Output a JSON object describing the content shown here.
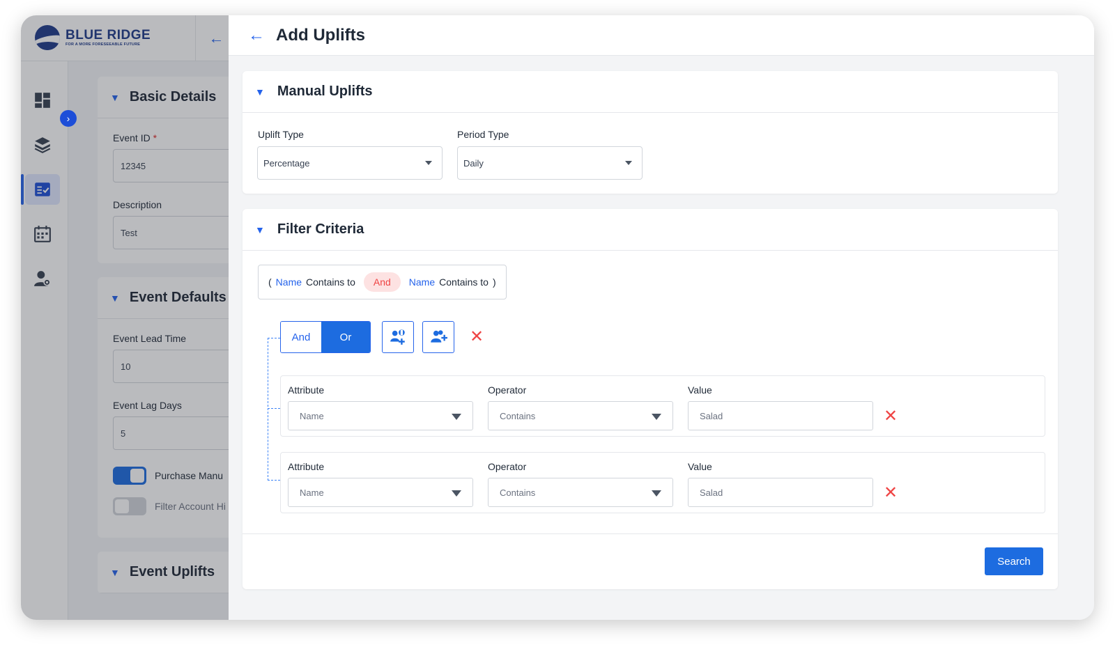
{
  "brand": {
    "name": "BLUE RIDGE",
    "tagline": "FOR A MORE FORESEEABLE FUTURE"
  },
  "background_form": {
    "basic_details": {
      "title": "Basic Details",
      "event_id_label": "Event ID",
      "event_id_required": "*",
      "event_id_value": "12345",
      "description_label": "Description",
      "description_value": "Test"
    },
    "event_defaults": {
      "title": "Event Defaults",
      "lead_time_label": "Event Lead Time",
      "lead_time_value": "10",
      "lag_days_label": "Event Lag Days",
      "lag_days_value": "5",
      "purchase_toggle_label": "Purchase Manu",
      "purchase_toggle_on": true,
      "filter_toggle_label": "Filter Account Hi",
      "filter_toggle_on": false
    },
    "event_uplifts": {
      "title": "Event Uplifts"
    }
  },
  "drawer": {
    "title": "Add Uplifts",
    "manual_uplifts": {
      "title": "Manual Uplifts",
      "uplift_type_label": "Uplift Type",
      "uplift_type_value": "Percentage",
      "period_type_label": "Period Type",
      "period_type_value": "Daily"
    },
    "filter_criteria": {
      "title": "Filter Criteria",
      "summary": {
        "open_paren": "(",
        "attr1": "Name",
        "op1": "Contains to",
        "joiner": "And",
        "attr2": "Name",
        "op2": "Contains to",
        "close_paren": ")"
      },
      "logic": {
        "and_label": "And",
        "or_label": "Or",
        "selected": "Or"
      },
      "conditions": [
        {
          "attribute_label": "Attribute",
          "attribute_value": "Name",
          "operator_label": "Operator",
          "operator_value": "Contains",
          "value_label": "Value",
          "value_value": "Salad"
        },
        {
          "attribute_label": "Attribute",
          "attribute_value": "Name",
          "operator_label": "Operator",
          "operator_value": "Contains",
          "value_label": "Value",
          "value_value": "Salad"
        }
      ],
      "search_label": "Search"
    }
  },
  "colors": {
    "primary": "#1d6ce0",
    "danger": "#ef4444",
    "brand": "#1e3a8a"
  }
}
